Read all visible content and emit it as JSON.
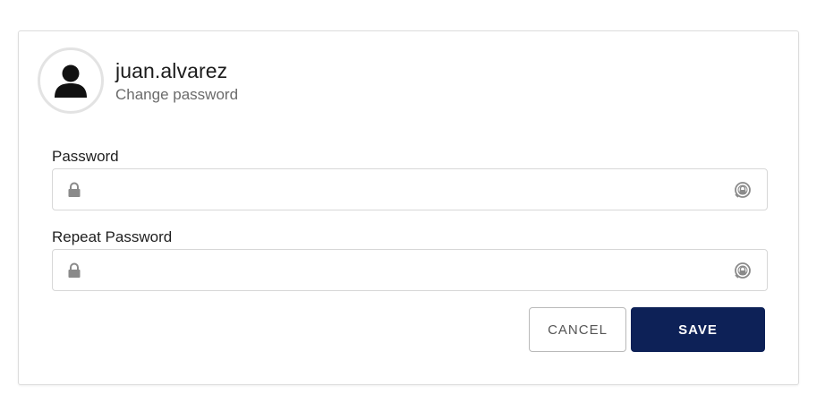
{
  "profile": {
    "username": "juan.alvarez",
    "subtitle": "Change password",
    "avatar_icon": "user-silhouette-icon"
  },
  "form": {
    "password": {
      "label": "Password",
      "value": "",
      "placeholder": "",
      "leading_icon": "lock-icon",
      "trailing_icon": "show-password-icon"
    },
    "repeat_password": {
      "label": "Repeat Password",
      "value": "",
      "placeholder": "",
      "leading_icon": "lock-icon",
      "trailing_icon": "show-password-icon"
    }
  },
  "actions": {
    "cancel_label": "CANCEL",
    "save_label": "SAVE"
  },
  "colors": {
    "primary": "#0d2157",
    "border": "#d7d7d7",
    "icon": "#8a8a8a"
  }
}
